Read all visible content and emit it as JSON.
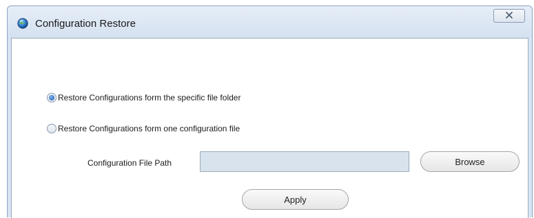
{
  "window": {
    "title": "Configuration Restore",
    "icon": "globe-icon",
    "close_icon": "close-x-icon"
  },
  "restore_options": [
    {
      "label": "Restore Configurations form the specific file folder",
      "selected": true
    },
    {
      "label": "Restore Configurations form one configuration file",
      "selected": false
    }
  ],
  "file_path": {
    "label": "Configuration File Path",
    "value": "",
    "placeholder": ""
  },
  "buttons": {
    "browse": "Browse",
    "apply": "Apply"
  },
  "colors": {
    "title_bar": "#d7e4f2",
    "input_background": "#d9e3ee",
    "radio_selected": "#1f5fb3"
  }
}
